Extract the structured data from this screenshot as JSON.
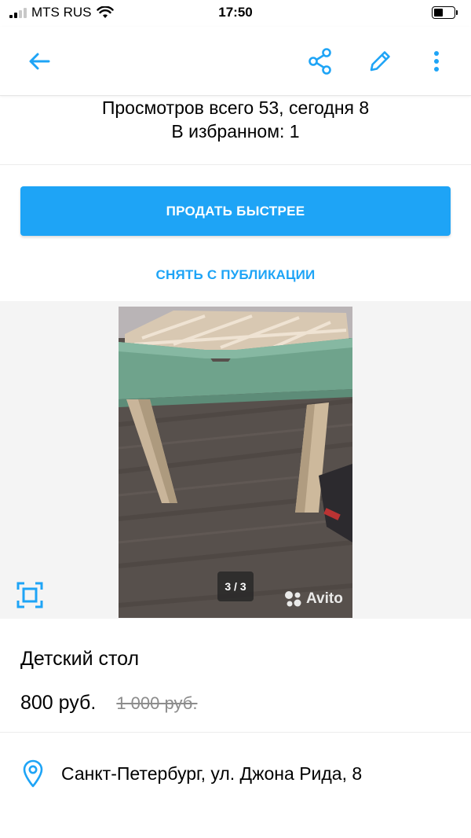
{
  "status_bar": {
    "carrier": "MTS RUS",
    "time": "17:50"
  },
  "nav": {
    "icons": [
      "arrow-left-icon",
      "share-icon",
      "pencil-icon",
      "more-vertical-icon"
    ]
  },
  "stats": {
    "views": "Просмотров всего 53, сегодня 8",
    "favorites": "В избранном: 1"
  },
  "actions": {
    "sell_faster": "ПРОДАТЬ БЫСТРЕЕ",
    "unpublish": "СНЯТЬ С ПУБЛИКАЦИИ"
  },
  "gallery": {
    "counter": "3 / 3",
    "watermark": "Avito"
  },
  "listing": {
    "title": "Детский стол",
    "price": "800 руб.",
    "old_price": "1 000 руб.",
    "address": "Санкт-Петербург, ул. Джона Рида, 8"
  },
  "colors": {
    "accent": "#1ea4f6",
    "table_green": "#6fa38c"
  }
}
